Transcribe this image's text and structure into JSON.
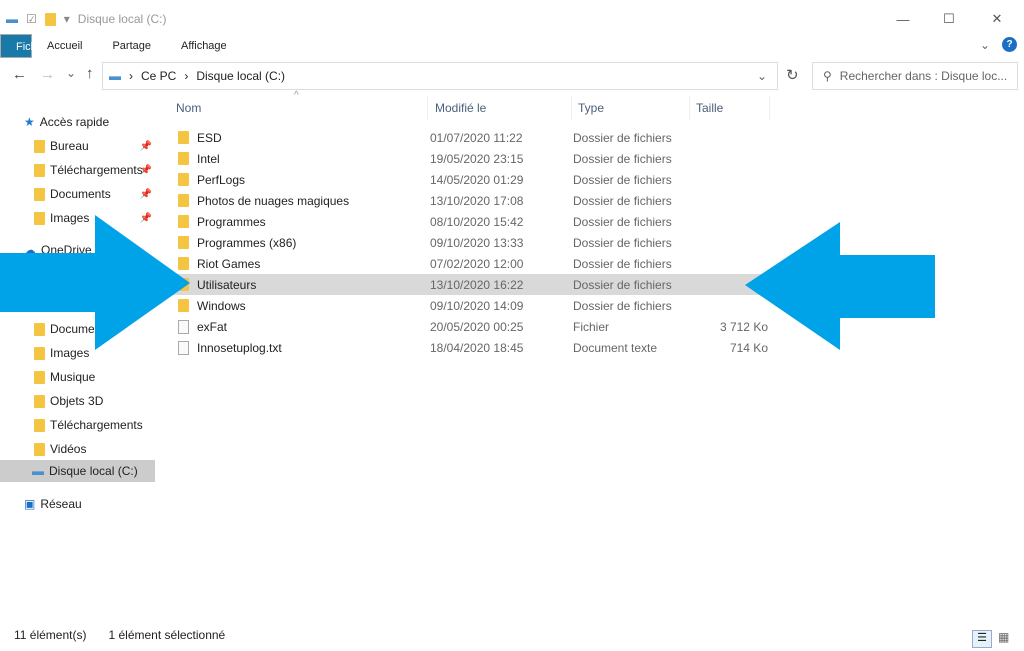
{
  "window": {
    "title": "Disque local (C:)",
    "minimize": "—",
    "maximize": "☐",
    "close": "✕"
  },
  "ribbon": {
    "tabs": [
      "Fichier",
      "Accueil",
      "Partage",
      "Affichage"
    ],
    "help": "?"
  },
  "nav": {
    "back": "←",
    "forward": "→",
    "recent": "⌄",
    "up": "↑",
    "refresh": "↻",
    "dropdown": "⌄"
  },
  "address": {
    "crumbs": [
      "Ce PC",
      "Disque local (C:)"
    ]
  },
  "search": {
    "placeholder": "Rechercher dans : Disque loc..."
  },
  "sidebar": {
    "quick": "Accès rapide",
    "quick_items": [
      "Bureau",
      "Téléchargements",
      "Documents",
      "Images"
    ],
    "onedrive": "OneDrive",
    "pc_items": [
      "Documents",
      "Images",
      "Musique",
      "Objets 3D",
      "Téléchargements",
      "Vidéos",
      "Disque local (C:)"
    ],
    "network": "Réseau"
  },
  "columns": [
    "Nom",
    "Modifié le",
    "Type",
    "Taille"
  ],
  "rows": [
    {
      "name": "ESD",
      "date": "01/07/2020 11:22",
      "type": "Dossier de fichiers",
      "size": "",
      "icon": "folder"
    },
    {
      "name": "Intel",
      "date": "19/05/2020 23:15",
      "type": "Dossier de fichiers",
      "size": "",
      "icon": "folder"
    },
    {
      "name": "PerfLogs",
      "date": "14/05/2020 01:29",
      "type": "Dossier de fichiers",
      "size": "",
      "icon": "folder"
    },
    {
      "name": "Photos de nuages magiques",
      "date": "13/10/2020 17:08",
      "type": "Dossier de fichiers",
      "size": "",
      "icon": "folder"
    },
    {
      "name": "Programmes",
      "date": "08/10/2020 15:42",
      "type": "Dossier de fichiers",
      "size": "",
      "icon": "folder"
    },
    {
      "name": "Programmes (x86)",
      "date": "09/10/2020 13:33",
      "type": "Dossier de fichiers",
      "size": "",
      "icon": "folder"
    },
    {
      "name": "Riot Games",
      "date": "07/02/2020 12:00",
      "type": "Dossier de fichiers",
      "size": "",
      "icon": "folder"
    },
    {
      "name": "Utilisateurs",
      "date": "13/10/2020 16:22",
      "type": "Dossier de fichiers",
      "size": "",
      "icon": "folder",
      "selected": true
    },
    {
      "name": "Windows",
      "date": "09/10/2020 14:09",
      "type": "Dossier de fichiers",
      "size": "",
      "icon": "folder"
    },
    {
      "name": "exFat",
      "date": "20/05/2020 00:25",
      "type": "Fichier",
      "size": "3 712 Ko",
      "icon": "file"
    },
    {
      "name": "Innosetuplog.txt",
      "date": "18/04/2020 18:45",
      "type": "Document texte",
      "size": "714 Ko",
      "icon": "file"
    }
  ],
  "status": {
    "count": "11 élément(s)",
    "selected": "1 élément sélectionné"
  },
  "colors": {
    "accent": "#1979a9",
    "arrow": "#00a2e8",
    "selection": "#d9d9d9"
  }
}
